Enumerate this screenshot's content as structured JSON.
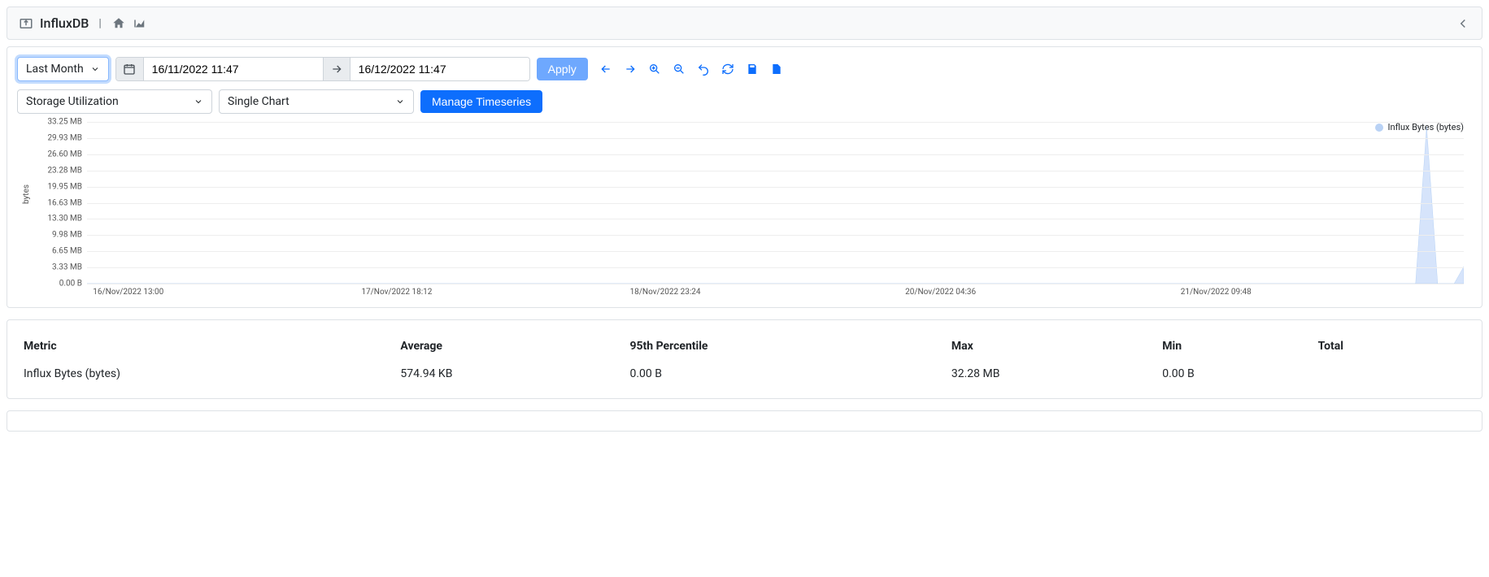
{
  "header": {
    "title": "InfluxDB"
  },
  "controls": {
    "preset": "Last Month",
    "date_from": "16/11/2022 11:47",
    "date_to": "16/12/2022 11:47",
    "apply": "Apply",
    "metric": "Storage Utilization",
    "chart_mode": "Single Chart",
    "manage": "Manage Timeseries"
  },
  "legend": {
    "series1": "Influx Bytes (bytes)"
  },
  "yaxis": {
    "title": "bytes",
    "ticks": [
      "33.25 MB",
      "29.93 MB",
      "26.60 MB",
      "23.28 MB",
      "19.95 MB",
      "16.63 MB",
      "13.30 MB",
      "9.98 MB",
      "6.65 MB",
      "3.33 MB",
      "0.00 B"
    ]
  },
  "xaxis": {
    "ticks": [
      "16/Nov/2022 13:00",
      "17/Nov/2022 18:12",
      "18/Nov/2022 23:24",
      "20/Nov/2022 04:36",
      "21/Nov/2022 09:48"
    ]
  },
  "stats": {
    "headers": [
      "Metric",
      "Average",
      "95th Percentile",
      "Max",
      "Min",
      "Total"
    ],
    "rows": [
      {
        "metric": "Influx Bytes (bytes)",
        "avg": "574.94 KB",
        "p95": "0.00 B",
        "max": "32.28 MB",
        "min": "0.00 B",
        "total": ""
      }
    ]
  },
  "chart_data": {
    "type": "area",
    "title": "",
    "xlabel": "",
    "ylabel": "bytes",
    "ylim_mb": [
      0,
      33.25
    ],
    "x_time_range": [
      "16/Nov/2022 13:00",
      "22/Nov/2022 12:00"
    ],
    "series": [
      {
        "name": "Influx Bytes (bytes)",
        "color": "#b9d2f5",
        "points_pct_x_mb": [
          [
            0,
            0
          ],
          [
            96.5,
            0
          ],
          [
            97.3,
            32.28
          ],
          [
            98.1,
            0
          ],
          [
            99.3,
            0
          ],
          [
            100,
            3.5
          ]
        ]
      }
    ]
  }
}
